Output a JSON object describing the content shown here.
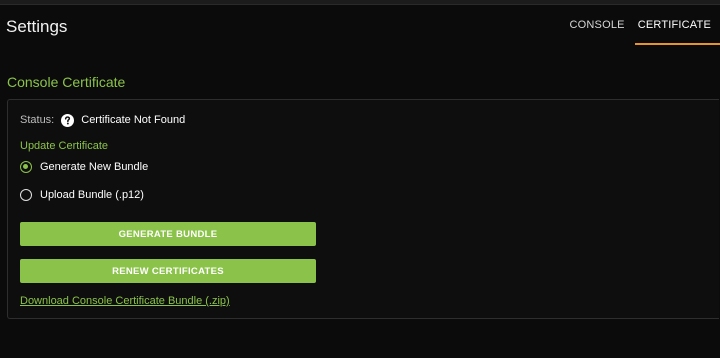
{
  "header": {
    "title": "Settings",
    "tabs": [
      {
        "label": "CONSOLE",
        "active": false
      },
      {
        "label": "CERTIFICATE",
        "active": true
      }
    ]
  },
  "section": {
    "title": "Console Certificate"
  },
  "status": {
    "label": "Status:",
    "icon": "question-circle-icon",
    "value": "Certificate Not Found"
  },
  "update": {
    "label": "Update Certificate",
    "options": [
      {
        "label": "Generate New Bundle",
        "selected": true
      },
      {
        "label": "Upload Bundle (.p12)",
        "selected": false
      }
    ]
  },
  "buttons": {
    "generate_label": "GENERATE BUNDLE",
    "renew_label": "RENEW CERTIFICATES"
  },
  "download": {
    "link_text": "Download Console Certificate Bundle (.zip)"
  },
  "colors": {
    "accent_green": "#8bc34a",
    "tab_underline": "#e8942e",
    "background": "#0b0b0b"
  }
}
